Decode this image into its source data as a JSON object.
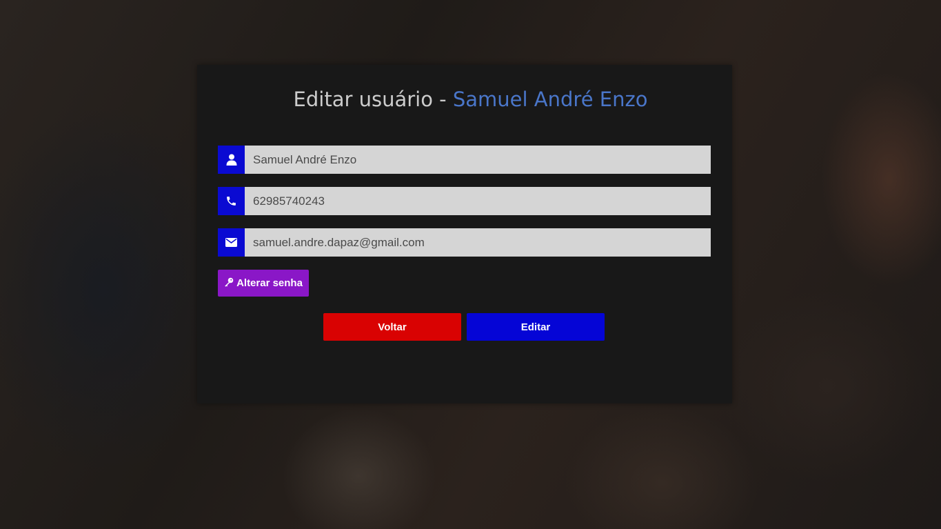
{
  "header": {
    "title_prefix": "Editar usuário",
    "title_separator": " - ",
    "title_name": "Samuel André Enzo"
  },
  "form": {
    "name": {
      "value": "Samuel André Enzo",
      "icon": "user-icon"
    },
    "phone": {
      "value": "62985740243",
      "icon": "phone-icon"
    },
    "email": {
      "value": "samuel.andre.dapaz@gmail.com",
      "icon": "envelope-icon"
    }
  },
  "buttons": {
    "change_password_label": "Alterar senha",
    "change_password_icon": "key-icon",
    "back_label": "Voltar",
    "edit_label": "Editar"
  },
  "colors": {
    "icon_bg": "#0a0ad2",
    "name_accent": "#4a76c9",
    "change_password": "#8a17c7",
    "back": "#d90202",
    "edit": "#0505d6"
  }
}
